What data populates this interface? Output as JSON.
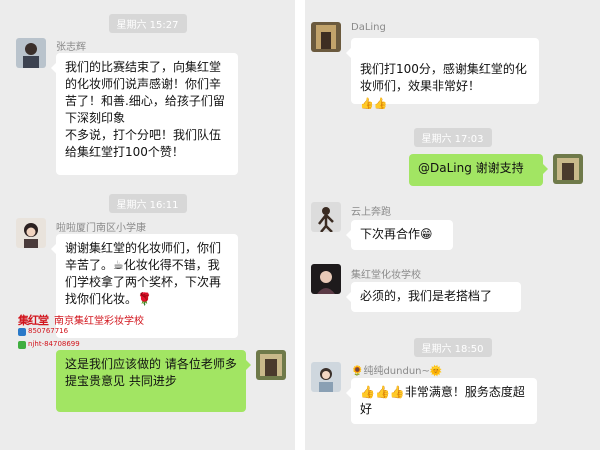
{
  "left": {
    "time1": "星期六 15:27",
    "msg1": {
      "sender": "张志辉",
      "text": "我们的比赛结束了，向集红堂的化妆师们说声感谢！你们辛苦了！和善.细心，给孩子们留下深刻印象\n不多说，打个分吧！我们队伍给集红堂打100个赞！"
    },
    "time2": "星期六 16:11",
    "msg2": {
      "sender": "啦啦厦门南区小学康",
      "text": "谢谢集红堂的化妆师们，你们辛苦了。☕化妆化得不错，我们学校拿了两个奖杯，下次再找你们化妆。🌹"
    },
    "msg3": {
      "text": "这是我们应该做的 请各位老师多提宝贵意见 共同进步"
    },
    "watermark": {
      "logo_text": "集红堂",
      "name": "南京集红堂彩妆学校",
      "line1": "850767716",
      "line2": "njht-84708699"
    }
  },
  "right": {
    "msg1": {
      "sender": "DaLing",
      "text": "我们打100分，感谢集红堂的化妆师们，效果非常好！",
      "emoji": "👍👍"
    },
    "time1": "星期六 17:03",
    "msg2": {
      "text": "@DaLing 谢谢支持"
    },
    "msg3": {
      "sender": "云上奔跑",
      "text": "下次再合作😁"
    },
    "msg4": {
      "sender": "集红堂化妆学校",
      "text": "必须的，我们是老搭档了"
    },
    "time2": "星期六 18:50",
    "msg5": {
      "sender": "纯纯dundun~",
      "sender_prefix": "🌻",
      "sender_suffix": "🌞",
      "text": "👍👍👍非常满意！服务态度超好"
    }
  },
  "colors": {
    "chat_bg": "#ececec",
    "sent_bubble": "#a2e563",
    "recv_bubble": "#ffffff",
    "time_chip": "#d7d7d7",
    "watermark": "#d2141c"
  }
}
